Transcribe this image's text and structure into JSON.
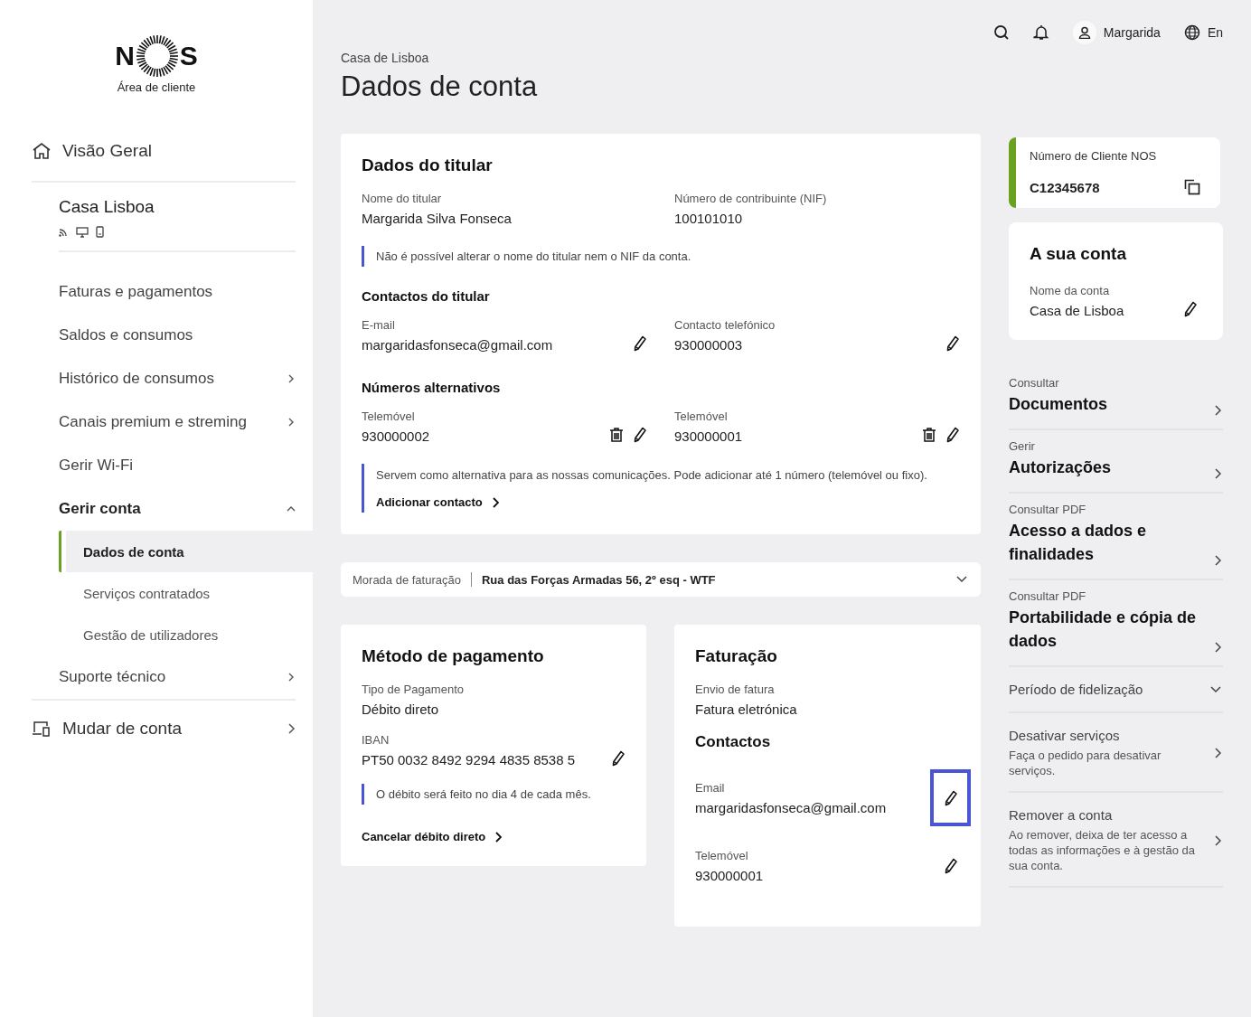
{
  "logo": {
    "letters": [
      "N",
      "S"
    ],
    "subtitle": "Área de cliente"
  },
  "sidebar": {
    "home": {
      "label": "Visão Geral"
    },
    "account": {
      "name": "Casa Lisboa"
    },
    "items": [
      {
        "label": "Faturas e pagamentos",
        "kind": "link",
        "expanded": false
      },
      {
        "label": "Saldos e consumos",
        "kind": "link",
        "expanded": false
      },
      {
        "label": "Histórico de consumos",
        "kind": "menu",
        "expanded": false
      },
      {
        "label": "Canais premium e streming",
        "kind": "menu",
        "expanded": false
      },
      {
        "label": "Gerir Wi-Fi",
        "kind": "link",
        "expanded": false
      },
      {
        "label": "Gerir conta",
        "kind": "menu",
        "expanded": true,
        "children": [
          {
            "label": "Dados de conta",
            "selected": true
          },
          {
            "label": "Serviços contratados",
            "selected": false
          },
          {
            "label": "Gestão de utilizadores",
            "selected": false
          }
        ]
      },
      {
        "label": "Suporte técnico",
        "kind": "menu",
        "expanded": false
      }
    ],
    "switch": {
      "label": "Mudar de conta"
    }
  },
  "header": {
    "user": "Margarida",
    "language": "En"
  },
  "breadcrumb": "Casa de Lisboa",
  "title": "Dados de conta",
  "holder": {
    "title": "Dados do titular",
    "fields": [
      {
        "label": "Nome do titular",
        "value": "Margarida Silva Fonseca"
      },
      {
        "label": "Número de contribuinte (NIF)",
        "value": "100101010"
      }
    ],
    "note": "Não é possível alterar o nome do titular nem o NIF da conta.",
    "contacts_title": "Contactos do titular",
    "contacts": [
      {
        "label": "E-mail",
        "value": "margaridasfonseca@gmail.com"
      },
      {
        "label": "Contacto telefónico",
        "value": "930000003"
      }
    ],
    "alt_title": "Números alternativos",
    "alt": [
      {
        "label": "Telemóvel",
        "value": "930000002"
      },
      {
        "label": "Telemóvel",
        "value": "930000001"
      }
    ],
    "alt_note": "Servem como alternativa para as nossas comunicações. Pode adicionar até 1 número (telemóvel ou fixo).",
    "add_link": "Adicionar contacto"
  },
  "billing_address": {
    "label": "Morada de faturação",
    "value": "Rua das Forças Armadas 56, 2º esq - WTF"
  },
  "payment": {
    "title": "Método de pagamento",
    "fields": [
      {
        "label": "Tipo de Pagamento",
        "value": "Débito direto",
        "editable": false
      },
      {
        "label": "IBAN",
        "value": "PT50 0032 8492 9294 4835 8538 5",
        "editable": true
      }
    ],
    "note": "O débito será feito no dia 4 de cada mês.",
    "cancel_link": "Cancelar débito direto"
  },
  "invoicing": {
    "title": "Faturação",
    "fields": [
      {
        "label": "Envio de fatura",
        "value": "Fatura eletrónica"
      }
    ],
    "contacts_title": "Contactos",
    "contacts": [
      {
        "label": "Email",
        "value": "margaridasfonseca@gmail.com",
        "focused": true
      },
      {
        "label": "Telemóvel",
        "value": "930000001",
        "focused": false
      }
    ]
  },
  "client_number": {
    "label": "Número de Cliente NOS",
    "value": "C12345678"
  },
  "account_card": {
    "title": "A sua conta",
    "label": "Nome da conta",
    "value": "Casa de Lisboa"
  },
  "links": [
    {
      "kind": "link",
      "kicker": "Consultar",
      "title": "Documentos"
    },
    {
      "kind": "link",
      "kicker": "Gerir",
      "title": "Autorizações"
    },
    {
      "kind": "link",
      "kicker": "Consultar PDF",
      "title": "Acesso a dados e finalidades"
    },
    {
      "kind": "link",
      "kicker": "Consultar PDF",
      "title": "Portabilidade e cópia de dados"
    },
    {
      "kind": "accordion",
      "title": "Período de fidelização",
      "expanded": false
    },
    {
      "kind": "action",
      "title": "Desativar serviços",
      "description": "Faça o pedido para desativar serviços."
    },
    {
      "kind": "action",
      "title": "Remover a conta",
      "description": "Ao remover, deixa de ter acesso a todas as informações e à gestão da sua conta."
    }
  ]
}
